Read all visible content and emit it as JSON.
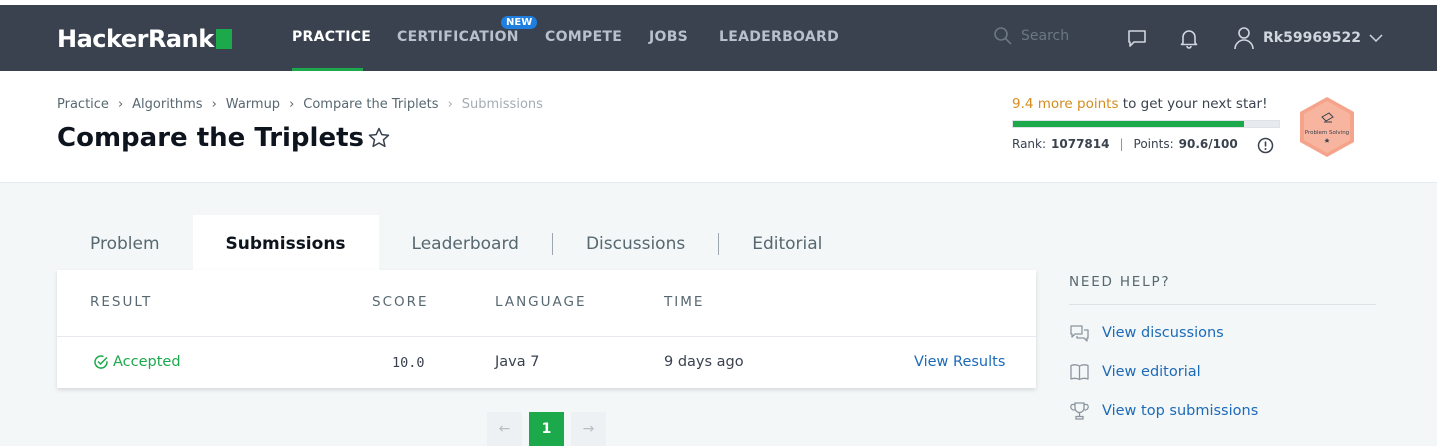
{
  "nav": {
    "logo": "HackerRank",
    "items": [
      "PRACTICE",
      "CERTIFICATION",
      "COMPETE",
      "JOBS",
      "LEADERBOARD"
    ],
    "new_badge": "NEW",
    "search_placeholder": "Search",
    "username": "Rk59969522"
  },
  "breadcrumb": [
    "Practice",
    "Algorithms",
    "Warmup",
    "Compare the Triplets",
    "Submissions"
  ],
  "page_title": "Compare the Triplets",
  "progress": {
    "points_needed": "9.4 more points",
    "suffix": " to get your next star!",
    "fraction": 0.87,
    "rank_label": "Rank:",
    "rank_value": "1077814",
    "points_label": "Points:",
    "points_value": "90.6/100",
    "badge_label": "Problem Solving"
  },
  "tabs": [
    "Problem",
    "Submissions",
    "Leaderboard",
    "Discussions",
    "Editorial"
  ],
  "table": {
    "headers": [
      "RESULT",
      "SCORE",
      "LANGUAGE",
      "TIME"
    ],
    "rows": [
      {
        "result": "Accepted",
        "score": "10.0",
        "language": "Java 7",
        "time": "9 days ago",
        "action": "View Results"
      }
    ]
  },
  "pager": {
    "prev": "←",
    "current": "1",
    "next": "→"
  },
  "help": {
    "title": "NEED HELP?",
    "items": [
      "View discussions",
      "View editorial",
      "View top submissions"
    ]
  },
  "colors": {
    "brand_green": "#1ba94c",
    "nav_bg": "#39424e",
    "link_blue": "#1c6ab8",
    "points_orange": "#d48c1e"
  }
}
